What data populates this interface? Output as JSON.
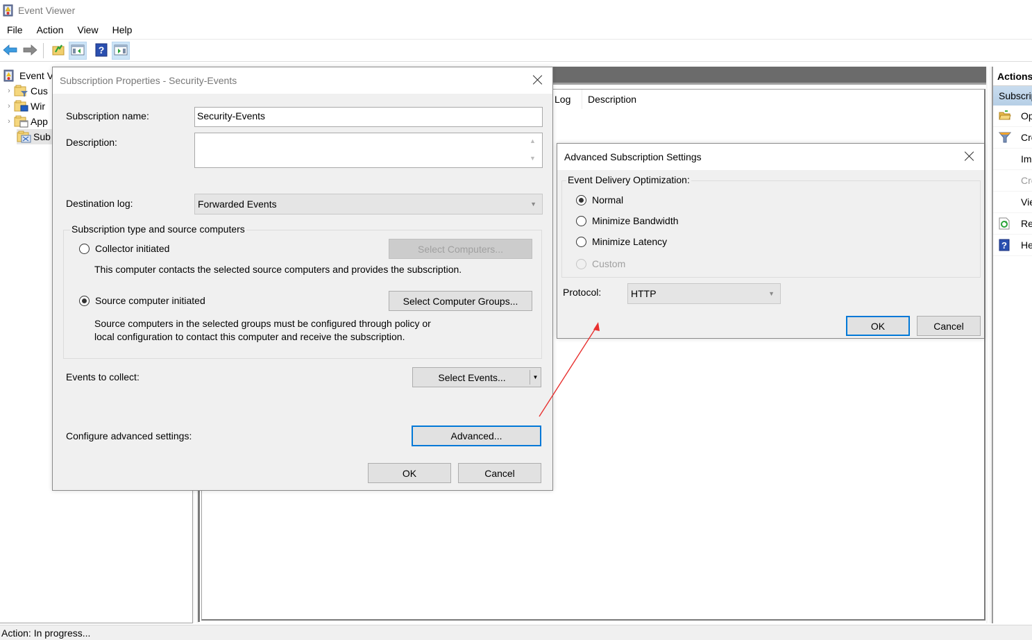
{
  "window": {
    "title": "Event Viewer",
    "icon": "event-viewer-icon"
  },
  "menubar": {
    "items": [
      "File",
      "Action",
      "View",
      "Help"
    ]
  },
  "toolbar": {
    "buttons": [
      {
        "name": "back",
        "icon": "back-arrow-icon"
      },
      {
        "name": "forward",
        "icon": "forward-arrow-icon"
      },
      {
        "name": "up-folder",
        "icon": "up-folder-icon"
      },
      {
        "name": "show-hide-console-tree",
        "icon": "console-tree-icon"
      },
      {
        "name": "help",
        "icon": "help-icon"
      },
      {
        "name": "show-hide-action-pane",
        "icon": "action-pane-icon"
      }
    ]
  },
  "tree": {
    "items": [
      {
        "label": "Event Viewer (Local)",
        "visible_label": "Event V",
        "icon": "event-viewer-icon",
        "expandable": false
      },
      {
        "label": "Custom Views",
        "visible_label": "Cus",
        "icon": "custom-views-folder-icon",
        "expandable": true
      },
      {
        "label": "Windows Logs",
        "visible_label": "Wir",
        "icon": "windows-logs-folder-icon",
        "expandable": true
      },
      {
        "label": "Applications and Services Logs",
        "visible_label": "App",
        "icon": "app-logs-folder-icon",
        "expandable": true
      },
      {
        "label": "Subscriptions",
        "visible_label": "Sub",
        "icon": "subscriptions-icon",
        "expandable": false,
        "selected": true
      }
    ]
  },
  "main": {
    "columns": [
      "Log",
      "Description"
    ]
  },
  "actions": {
    "title": "Actions",
    "section": "Subscriptions",
    "items": [
      {
        "label": "Open Saved Log...",
        "visible_label": "Op",
        "icon": "open-folder-icon",
        "enabled": true
      },
      {
        "label": "Create Custom View...",
        "visible_label": "Cre",
        "icon": "filter-icon",
        "enabled": true
      },
      {
        "label": "Import Custom View...",
        "visible_label": "Im",
        "icon": "",
        "enabled": true
      },
      {
        "label": "Create Subscription...",
        "visible_label": "Cre",
        "icon": "",
        "enabled": false
      },
      {
        "label": "View",
        "visible_label": "Vie",
        "icon": "",
        "enabled": true
      },
      {
        "label": "Refresh",
        "visible_label": "Re",
        "icon": "refresh-icon",
        "enabled": true
      },
      {
        "label": "Help",
        "visible_label": "He",
        "icon": "help-icon",
        "enabled": true
      }
    ]
  },
  "status": {
    "text": "Action:  In progress..."
  },
  "subscription_dialog": {
    "title": "Subscription Properties - Security-Events",
    "name_label": "Subscription name:",
    "name_value": "Security-Events",
    "description_label": "Description:",
    "description_value": "",
    "destination_label": "Destination log:",
    "destination_value": "Forwarded Events",
    "group_label": "Subscription type and source computers",
    "collector_label": "Collector initiated",
    "collector_checked": false,
    "select_computers_label": "Select Computers...",
    "collector_desc": "This computer contacts the selected source computers and provides the subscription.",
    "source_label": "Source computer initiated",
    "source_checked": true,
    "select_groups_label": "Select Computer Groups...",
    "source_desc_line1": "Source computers in the selected groups must be configured through policy or",
    "source_desc_line2": "local configuration to contact this computer and receive the subscription.",
    "events_label": "Events to collect:",
    "select_events_label": "Select Events...",
    "advanced_label": "Configure advanced settings:",
    "advanced_button": "Advanced...",
    "ok_label": "OK",
    "cancel_label": "Cancel"
  },
  "advanced_dialog": {
    "title": "Advanced Subscription Settings",
    "group_label": "Event Delivery Optimization:",
    "options": [
      {
        "label": "Normal",
        "checked": true,
        "enabled": true
      },
      {
        "label": "Minimize Bandwidth",
        "checked": false,
        "enabled": true
      },
      {
        "label": "Minimize Latency",
        "checked": false,
        "enabled": true
      },
      {
        "label": "Custom",
        "checked": false,
        "enabled": false
      }
    ],
    "protocol_label": "Protocol:",
    "protocol_value": "HTTP",
    "ok_label": "OK",
    "cancel_label": "Cancel"
  },
  "annotation": {
    "arrow_color": "#e8302f"
  }
}
